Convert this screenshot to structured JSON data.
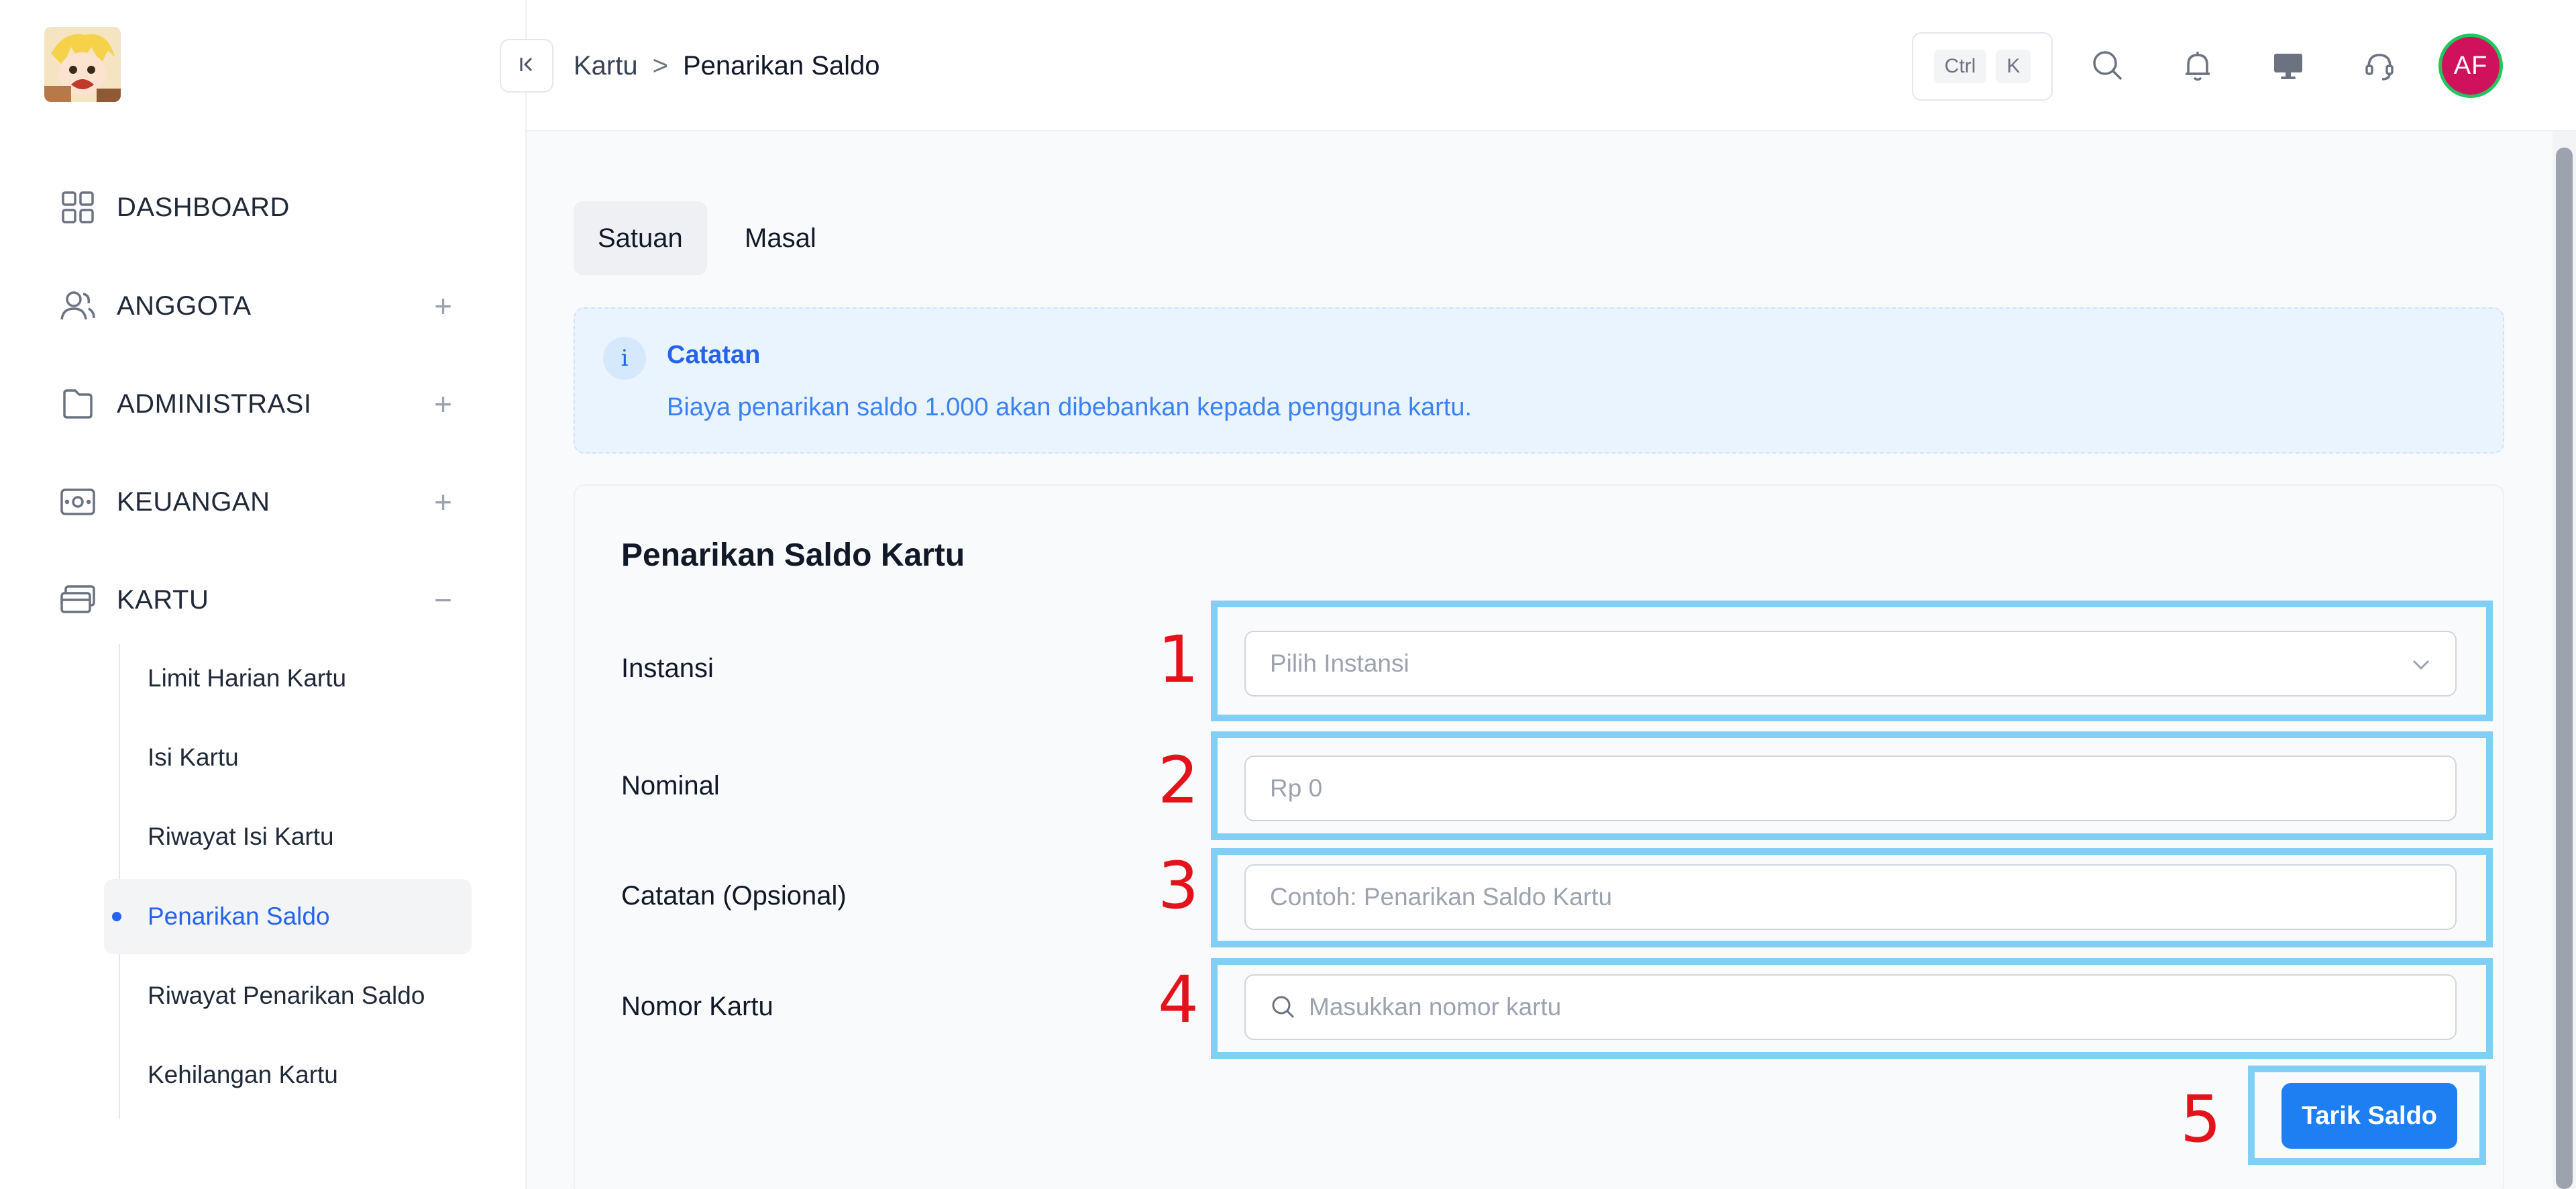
{
  "sidebar": {
    "items": [
      {
        "label": "DASHBOARD",
        "icon": "grid-icon"
      },
      {
        "label": "ANGGOTA",
        "icon": "users-icon",
        "toggle": "+"
      },
      {
        "label": "ADMINISTRASI",
        "icon": "folder-icon",
        "toggle": "+"
      },
      {
        "label": "KEUANGAN",
        "icon": "money-icon",
        "toggle": "+"
      },
      {
        "label": "KARTU",
        "icon": "card-icon",
        "toggle": "−"
      }
    ],
    "sub_items": [
      {
        "label": "Limit Harian Kartu"
      },
      {
        "label": "Isi Kartu"
      },
      {
        "label": "Riwayat Isi Kartu"
      },
      {
        "label": "Penarikan Saldo",
        "active": true
      },
      {
        "label": "Riwayat Penarikan Saldo"
      },
      {
        "label": "Kehilangan Kartu"
      }
    ]
  },
  "header": {
    "breadcrumb": {
      "parent": "Kartu",
      "separator": ">",
      "current": "Penarikan Saldo"
    },
    "shortcut": {
      "key1": "Ctrl",
      "key2": "K"
    },
    "avatar_initials": "AF"
  },
  "tabs": [
    {
      "label": "Satuan",
      "active": true
    },
    {
      "label": "Masal"
    }
  ],
  "alert": {
    "icon": "i",
    "title": "Catatan",
    "body": "Biaya penarikan saldo 1.000 akan dibebankan kepada pengguna kartu."
  },
  "form": {
    "title": "Penarikan Saldo Kartu",
    "fields": [
      {
        "label": "Instansi",
        "placeholder": "Pilih Instansi"
      },
      {
        "label": "Nominal",
        "placeholder": "Rp 0"
      },
      {
        "label": "Catatan (Opsional)",
        "placeholder": "Contoh: Penarikan Saldo Kartu"
      },
      {
        "label": "Nomor Kartu",
        "placeholder": "Masukkan nomor kartu"
      }
    ],
    "submit_label": "Tarik Saldo"
  },
  "annotations": [
    "1",
    "2",
    "3",
    "4",
    "5"
  ],
  "colors": {
    "accent": "#1d7ff2",
    "highlight_box": "#82cff5",
    "annotation": "#e3121b",
    "avatar": "#d0115b"
  }
}
